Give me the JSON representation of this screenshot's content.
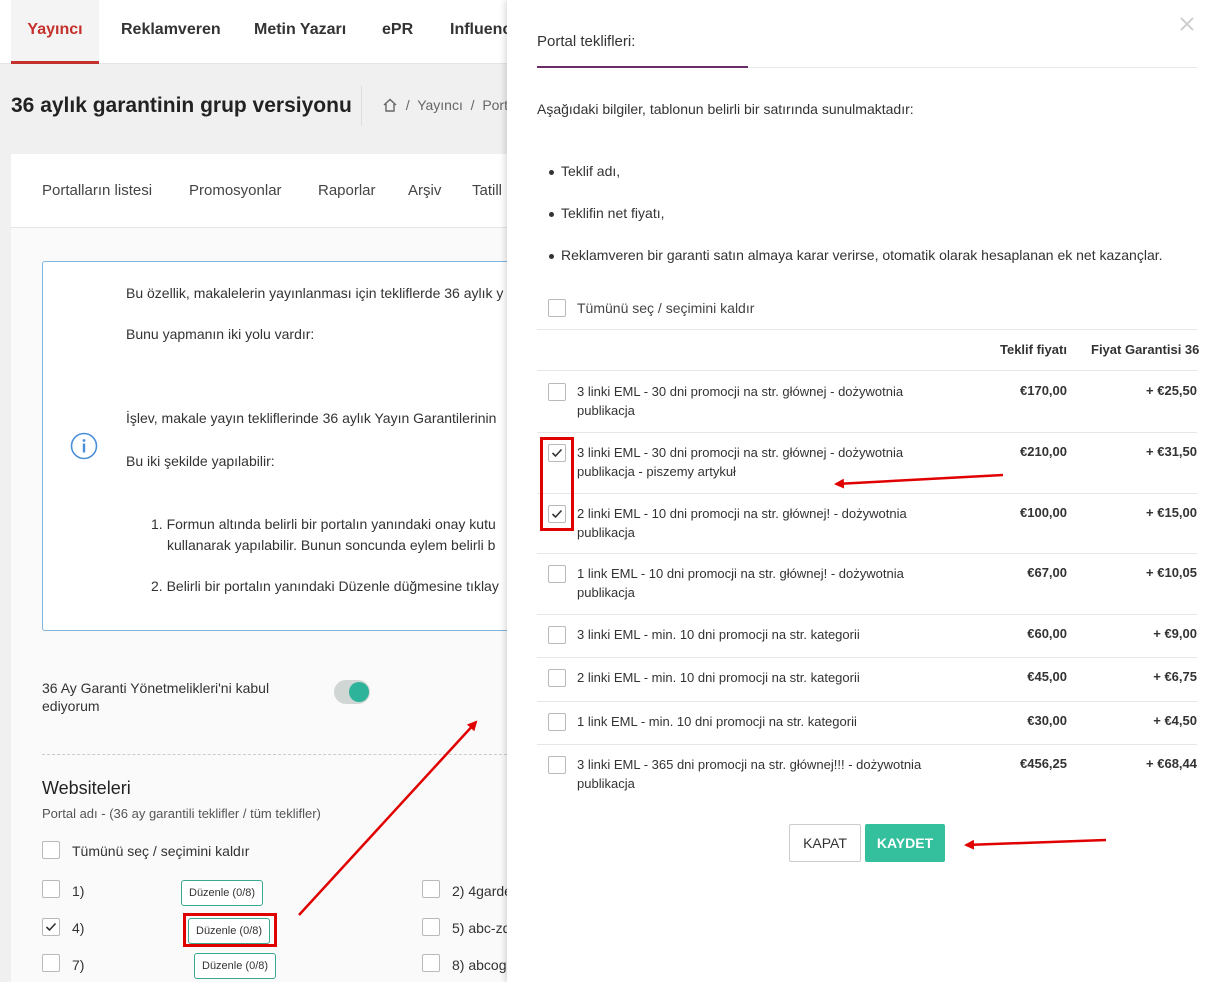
{
  "topnav": {
    "tabs": [
      {
        "label": "Yayıncı"
      },
      {
        "label": "Reklamveren"
      },
      {
        "label": "Metin Yazarı"
      },
      {
        "label": "ePR"
      },
      {
        "label": "Influencer"
      }
    ]
  },
  "page": {
    "title": "36 aylık garantinin grup versiyonu",
    "breadcrumb": [
      "Yayıncı",
      "Port"
    ]
  },
  "subtabs": [
    "Portalların listesi",
    "Promosyonlar",
    "Raporlar",
    "Arşiv",
    "Tatill"
  ],
  "info": {
    "lines": [
      "Bu özellik, makalelerin yayınlanması için tekliflerde 36 aylık y",
      "Bunu yapmanın iki yolu vardır:",
      "İşlev, makale yayın tekliflerinde 36 aylık Yayın Garantilerinin",
      "Bu iki şekilde yapılabilir:",
      "1. Formun altında belirli bir portalın yanındaki onay kutu",
      "kullanarak yapılabilir. Bunun soncunda eylem belirli b",
      "2. Belirli bir portalın yanındaki Düzenle düğmesine tıklay"
    ]
  },
  "terms": {
    "label": "36 Ay Garanti Yönetmelikleri'ni kabul ediyorum",
    "enabled": true
  },
  "websites": {
    "title": "Websiteleri",
    "subtitle": "Portal adı - (36 ay garantili teklifler / tüm teklifler)",
    "select_all": "Tümünü seç / seçimini kaldır",
    "items": [
      {
        "label": "1)",
        "edit": "Düzenle (0/8)",
        "checked": false
      },
      {
        "label": "2) 4garde",
        "checked": false
      },
      {
        "label": "4)",
        "edit": "Düzenle (0/8)",
        "checked": true
      },
      {
        "label": "5) abc-zd",
        "checked": false
      },
      {
        "label": "7)",
        "edit": "Düzenle (0/8)",
        "checked": false
      },
      {
        "label": "8) abcog",
        "checked": false
      }
    ]
  },
  "modal": {
    "title": "Portal teklifleri:",
    "intro": "Aşağıdaki bilgiler, tablonun belirli bir satırında sunulmaktadır:",
    "bullets": [
      "Teklif adı,",
      "Teklifin net fiyatı,",
      "Reklamveren bir garanti satın almaya karar verirse, otomatik olarak hesaplanan ek net kazançlar."
    ],
    "select_all": "Tümünü seç / seçimini kaldır",
    "columns": {
      "price": "Teklif fiyatı",
      "guarantee": "Fiyat Garantisi 36"
    },
    "rows": [
      {
        "name": "3 linki EML - 30 dni promocji na str. głównej - dożywotnia publikacja",
        "price": "€170,00",
        "guarantee": "+ €25,50",
        "checked": false
      },
      {
        "name": "3 linki EML - 30 dni promocji na str. głównej - dożywotnia publikacja - piszemy artykuł",
        "price": "€210,00",
        "guarantee": "+ €31,50",
        "checked": true
      },
      {
        "name": "2 linki EML - 10 dni promocji na str. głównej! - dożywotnia publikacja",
        "price": "€100,00",
        "guarantee": "+ €15,00",
        "checked": true
      },
      {
        "name": "1 link EML - 10 dni promocji na str. głównej! - dożywotnia publikacja",
        "price": "€67,00",
        "guarantee": "+ €10,05",
        "checked": false
      },
      {
        "name": "3 linki EML - min. 10 dni promocji na str. kategorii",
        "price": "€60,00",
        "guarantee": "+ €9,00",
        "checked": false
      },
      {
        "name": "2 linki EML - min. 10 dni promocji na str. kategorii",
        "price": "€45,00",
        "guarantee": "+ €6,75",
        "checked": false
      },
      {
        "name": "1 link EML - min. 10 dni promocji na str. kategorii",
        "price": "€30,00",
        "guarantee": "+ €4,50",
        "checked": false
      },
      {
        "name": "3 linki EML - 365 dni promocji na str. głównej!!! - dożywotnia publikacja",
        "price": "€456,25",
        "guarantee": "+ €68,44",
        "checked": false
      }
    ],
    "buttons": {
      "close": "KAPAT",
      "save": "KAYDET"
    }
  },
  "colors": {
    "accent_red": "#c4302b",
    "save_green": "#34bf9d",
    "annotation_red": "#e10000",
    "info_blue": "#4a90d9"
  }
}
